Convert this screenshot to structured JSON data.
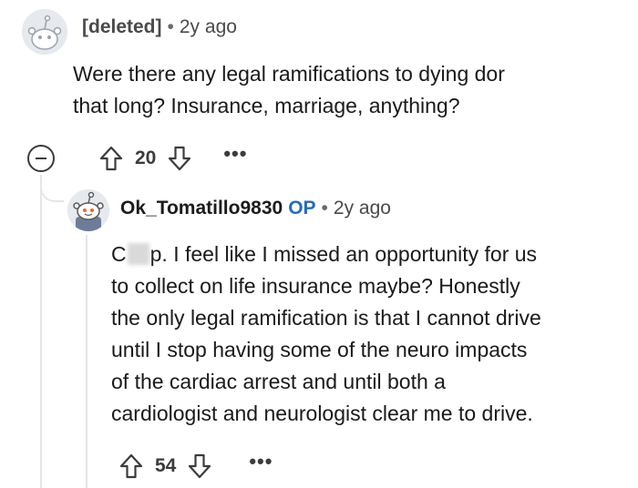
{
  "comment": {
    "author": "[deleted]",
    "separator": "•",
    "age": "2y ago",
    "body": "Were there any legal ramifications to dying dor\nthat long? Insurance, marriage, anything?",
    "score": "20",
    "more": "•••"
  },
  "reply": {
    "author": "Ok_Tomatillo9830",
    "badge": "OP",
    "separator": "•",
    "age": "2y ago",
    "body_start": "C",
    "body_rest": "p. I feel like I missed an opportunity for us\nto collect on life insurance maybe? Honestly\nthe only legal ramification is that I cannot drive\nuntil I stop having some of the neuro impacts\nof the cardiac arrest and until both a\ncardiologist and neurologist clear me to drive.",
    "score": "54",
    "more": "•••"
  },
  "icons": {
    "collapse": "minus-circle-icon",
    "upvote": "arrow-up-outline-icon",
    "downvote": "arrow-down-outline-icon",
    "more": "ellipsis-icon",
    "avatar": "snoo-avatar-icon"
  },
  "colors": {
    "op_badge": "#2b6cb0",
    "thread_line": "#e3e6ea",
    "icon": "#3c3c3c"
  }
}
